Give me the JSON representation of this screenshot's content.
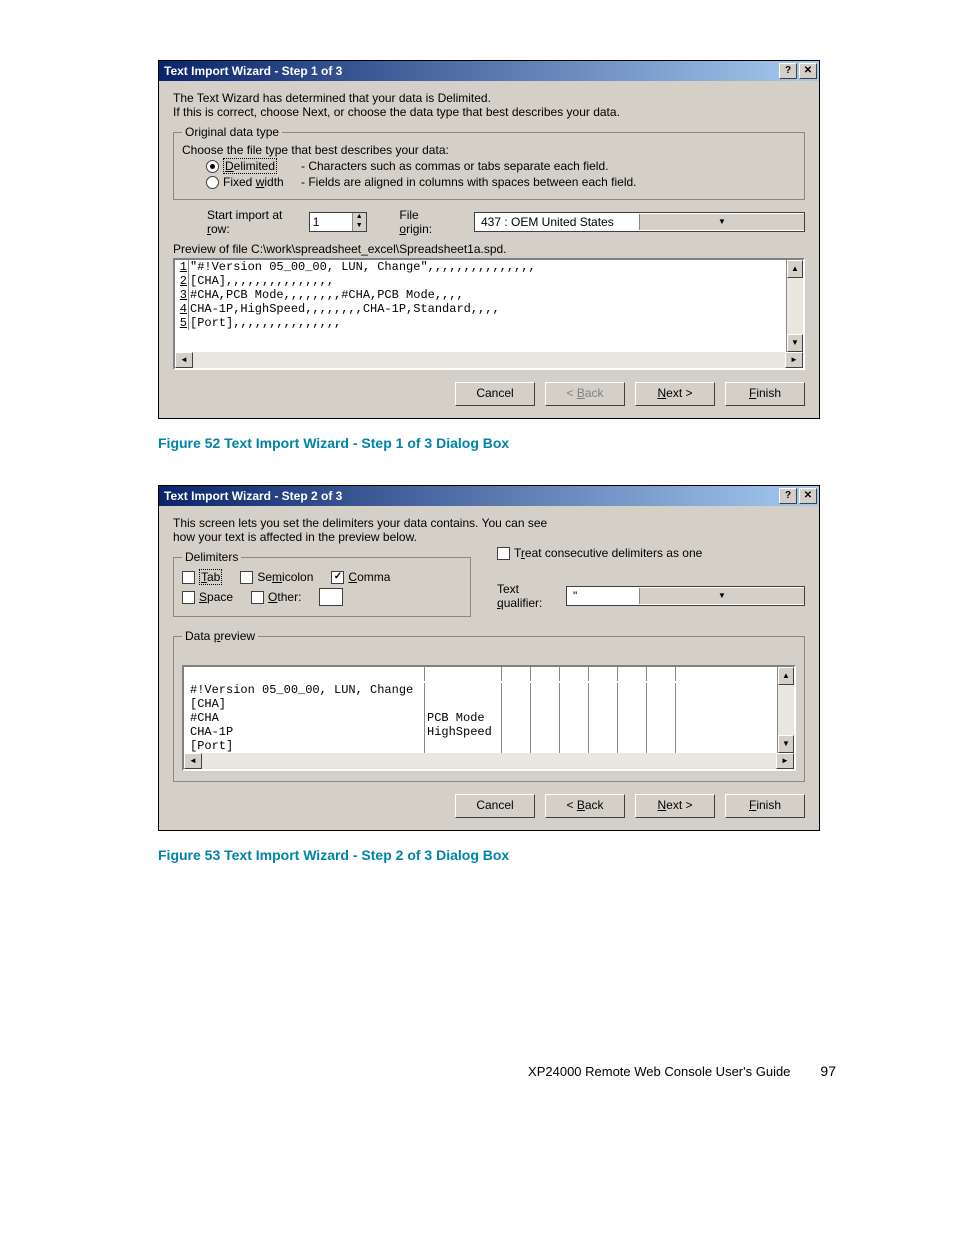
{
  "dialog1": {
    "title": "Text Import Wizard - Step 1 of 3",
    "intro_line1": "The Text Wizard has determined that your data is Delimited.",
    "intro_line2": "If this is correct, choose Next, or choose the data type that best describes your data.",
    "group_legend": "Original data type",
    "choose_label": "Choose the file type that best describes your data:",
    "radio_delimited_pre": "D",
    "radio_delimited_rest": "elimited",
    "radio_delimited_desc": "- Characters such as commas or tabs separate each field.",
    "radio_fixed_label": "Fixed ",
    "radio_fixed_u": "w",
    "radio_fixed_rest": "idth",
    "radio_fixed_desc": "- Fields are aligned in columns with spaces between each field.",
    "start_row_label": "Start import at ",
    "start_row_u": "r",
    "start_row_rest": "ow:",
    "start_row_value": "1",
    "file_origin_label": "File ",
    "file_origin_u": "o",
    "file_origin_rest": "rigin:",
    "file_origin_value": "437 : OEM United States",
    "preview_label": "Preview of file C:\\work\\spreadsheet_excel\\Spreadsheet1a.spd.",
    "preview_lines": [
      {
        "n": "1",
        "t": "\"#!Version 05_00_00, LUN, Change\",,,,,,,,,,,,,,,"
      },
      {
        "n": "2",
        "t": "[CHA],,,,,,,,,,,,,,,"
      },
      {
        "n": "3",
        "t": "#CHA,PCB Mode,,,,,,,,#CHA,PCB Mode,,,,"
      },
      {
        "n": "4",
        "t": "CHA-1P,HighSpeed,,,,,,,,CHA-1P,Standard,,,,"
      },
      {
        "n": "5",
        "t": "[Port],,,,,,,,,,,,,,,"
      }
    ],
    "btn_cancel": "Cancel",
    "btn_back_lt": "< ",
    "btn_back_u": "B",
    "btn_back_rest": "ack",
    "btn_next_u": "N",
    "btn_next_rest": "ext >",
    "btn_finish_u": "F",
    "btn_finish_rest": "inish"
  },
  "caption1": "Figure 52 Text Import Wizard - Step 1 of 3 Dialog Box",
  "dialog2": {
    "title": "Text Import Wizard - Step 2 of 3",
    "intro_line1": "This screen lets you set the delimiters your data contains.  You can see",
    "intro_line2": "how your text is affected in the preview below.",
    "delimiters_legend": "Delimiters",
    "cb_tab_u": "T",
    "cb_tab_rest": "ab",
    "cb_semicolon_pre": "Se",
    "cb_semicolon_u": "m",
    "cb_semicolon_rest": "icolon",
    "cb_comma_u": "C",
    "cb_comma_rest": "omma",
    "cb_space_u": "S",
    "cb_space_rest": "pace",
    "cb_other_u": "O",
    "cb_other_rest": "ther:",
    "cb_treat_pre": "T",
    "cb_treat_u": "r",
    "cb_treat_rest": "eat consecutive delimiters as one",
    "qualifier_label_pre": "Text ",
    "qualifier_label_u": "q",
    "qualifier_label_rest": "ualifier:",
    "qualifier_value": "\"",
    "data_preview_legend": "Data ",
    "data_preview_u": "p",
    "data_preview_rest": "review",
    "dp_rows": [
      [
        "#!Version 05_00_00, LUN, Change",
        "",
        "",
        "",
        "",
        ""
      ],
      [
        "[CHA]",
        "",
        "",
        "",
        "",
        ""
      ],
      [
        "#CHA",
        "PCB Mode",
        "",
        "",
        "",
        ""
      ],
      [
        "CHA-1P",
        "HighSpeed",
        "",
        "",
        "",
        ""
      ],
      [
        "[Port]",
        "",
        "",
        "",
        "",
        ""
      ]
    ],
    "btn_cancel": "Cancel",
    "btn_back_lt": "< ",
    "btn_back_u": "B",
    "btn_back_rest": "ack",
    "btn_next_u": "N",
    "btn_next_rest": "ext >",
    "btn_finish_u": "F",
    "btn_finish_rest": "inish"
  },
  "caption2": "Figure 53 Text Import Wizard - Step 2 of 3 Dialog Box",
  "footer_title": "XP24000 Remote Web Console User's Guide",
  "footer_page": "97"
}
